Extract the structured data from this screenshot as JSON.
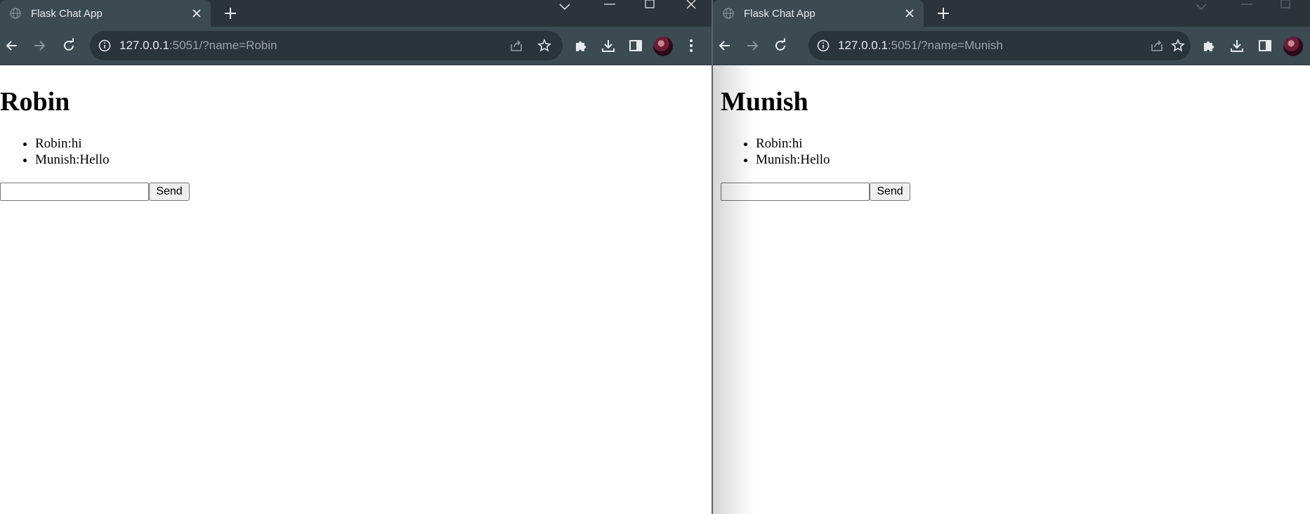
{
  "windows": [
    {
      "tab": {
        "title": "Flask Chat App"
      },
      "address": {
        "host": "127.0.0.1",
        "rest": ":5051/?name=Robin"
      },
      "page": {
        "heading": "Robin",
        "messages": [
          "Robin:hi",
          "Munish:Hello"
        ],
        "input_value": "",
        "send_label": "Send"
      }
    },
    {
      "tab": {
        "title": "Flask Chat App"
      },
      "address": {
        "host": "127.0.0.1",
        "rest": ":5051/?name=Munish"
      },
      "page": {
        "heading": "Munish",
        "messages": [
          "Robin:hi",
          "Munish:Hello"
        ],
        "input_value": "",
        "send_label": "Send"
      }
    }
  ],
  "icons": {
    "favicon": "globe-icon",
    "tab_close": "close-icon",
    "new_tab": "plus-icon",
    "tab_search": "chevron-down-icon",
    "minimize": "minimize-icon",
    "maximize": "maximize-icon",
    "close_window": "close-icon",
    "back": "arrow-left-icon",
    "forward": "arrow-right-icon",
    "reload": "reload-icon",
    "site_info": "info-icon",
    "share": "share-icon",
    "bookmark": "star-icon",
    "extensions": "puzzle-icon",
    "downloads": "download-icon",
    "side_panel": "side-panel-icon",
    "profile": "avatar",
    "menu": "kebab-menu-icon"
  },
  "colors": {
    "tabstrip_bg": "#2b343a",
    "toolbar_bg": "#3c4a52",
    "omnibox_bg": "#29343b",
    "icon": "#e8eaed"
  }
}
